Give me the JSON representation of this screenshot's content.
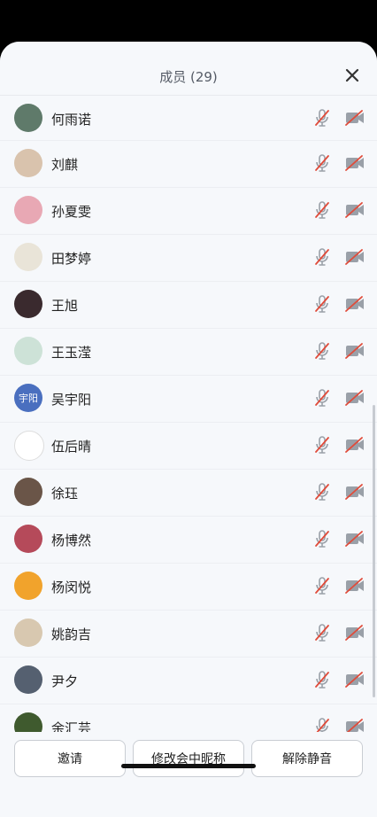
{
  "header": {
    "title": "成员 (29)"
  },
  "members": [
    {
      "name": "何雨诺",
      "avatar_color": "#5f7a6a"
    },
    {
      "name": "刘麒",
      "avatar_color": "#d9c3ad"
    },
    {
      "name": "孙夏雯",
      "avatar_color": "#e8a8b4"
    },
    {
      "name": "田梦婷",
      "avatar_color": "#e9e4d8"
    },
    {
      "name": "王旭",
      "avatar_color": "#3a2a2e"
    },
    {
      "name": "王玉滢",
      "avatar_color": "#cde2d7"
    },
    {
      "name": "吴宇阳",
      "avatar_color": "#4a6fbf",
      "avatar_text": "宇阳"
    },
    {
      "name": "伍后晴",
      "avatar_color": "#ffffff"
    },
    {
      "name": "徐珏",
      "avatar_color": "#6a5548"
    },
    {
      "name": "杨博然",
      "avatar_color": "#b54a5a"
    },
    {
      "name": "杨闵悦",
      "avatar_color": "#f1a32c"
    },
    {
      "name": "姚韵吉",
      "avatar_color": "#d8c8b0"
    },
    {
      "name": "尹夕",
      "avatar_color": "#556070"
    },
    {
      "name": "余汇芸",
      "avatar_color": "#3f5a2e"
    }
  ],
  "footer": {
    "invite_label": "邀请",
    "rename_label": "修改会中昵称",
    "unmute_label": "解除静音"
  },
  "colors": {
    "muted_icon": "#e04b3a",
    "icon_gray": "#9aa0a8"
  }
}
